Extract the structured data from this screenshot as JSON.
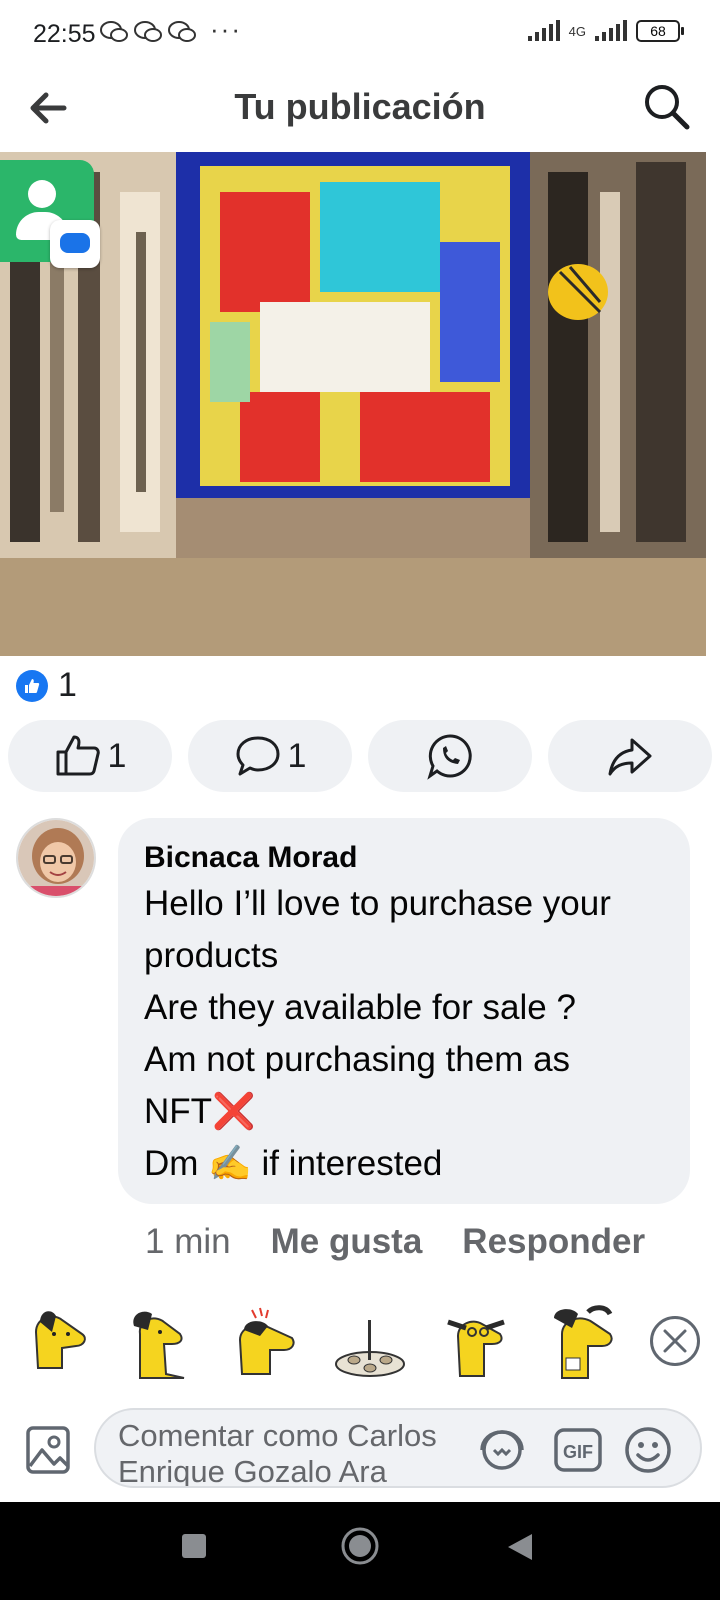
{
  "status_bar": {
    "time": "22:55",
    "network": "4G",
    "battery": "68"
  },
  "header": {
    "title": "Tu publicación"
  },
  "reactions": {
    "like_count": "1"
  },
  "actions": {
    "like_count": "1",
    "comment_count": "1"
  },
  "comment": {
    "author": "Bicnaca Morad",
    "text": "Hello I’ll love to purchase your products\nAre they available for sale ?\nAm not purchasing them as NFT❌\nDm ✍️ if interested",
    "time": "1 min",
    "like_label": "Me gusta",
    "reply_label": "Responder"
  },
  "composer": {
    "placeholder": "Comentar como Carlos Enrique Gozalo Ara"
  },
  "colors": {
    "brand_blue": "#1877f2",
    "pill_bg": "#eff1f4",
    "muted_text": "#65676b"
  }
}
